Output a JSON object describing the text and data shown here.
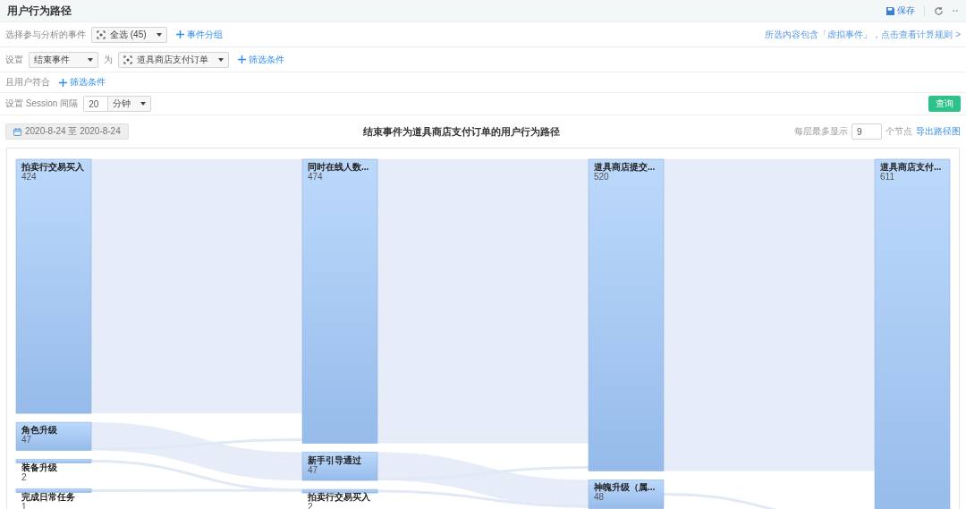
{
  "header": {
    "title": "用户行为路径",
    "save": "保存"
  },
  "event_row": {
    "label": "选择参与分析的事件",
    "select": "全选 (45)",
    "add_link": "事件分组",
    "notice_link": "所选内容包含「虚拟事件」，点击查看计算规则 >"
  },
  "set_row": {
    "label": "设置",
    "type_select": "结束事件",
    "connector": "为",
    "event_select": "道具商店支付订单",
    "add_link": "筛选条件"
  },
  "user_row": {
    "label": "且用户符合",
    "add_link": "筛选条件"
  },
  "session_row": {
    "label": "设置 Session 间隔",
    "value": "20",
    "unit_select": "分钟",
    "query_button": "查询"
  },
  "toolbar": {
    "date_range": "2020-8-24 至 2020-8-24",
    "chart_title": "结束事件为道具商店支付订单的用户行为路径",
    "per_layer_label": "每层最多显示",
    "per_layer_value": "9",
    "per_layer_unit": "个节点",
    "export_link": "导出路径图"
  },
  "columns": [
    {
      "nodes": [
        {
          "label": "拍卖行交易买入",
          "count": "424"
        },
        {
          "label": "角色升级",
          "count": "47"
        },
        {
          "label": "装备升级",
          "count": "2"
        },
        {
          "label": "完成日常任务",
          "count": "1"
        }
      ]
    },
    {
      "nodes": [
        {
          "label": "同时在线人数...",
          "count": "474"
        },
        {
          "label": "新手引导通过",
          "count": "47"
        },
        {
          "label": "拍卖行交易买入",
          "count": "2"
        }
      ]
    },
    {
      "nodes": [
        {
          "label": "道具商店提交...",
          "count": "520"
        },
        {
          "label": "神魄升级（属...",
          "count": "48"
        }
      ]
    },
    {
      "nodes": [
        {
          "label": "道具商店支付...",
          "count": "611"
        }
      ]
    }
  ]
}
